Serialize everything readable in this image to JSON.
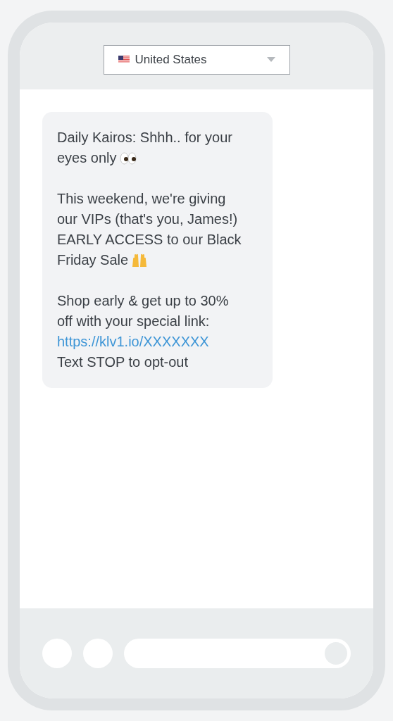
{
  "country_select": {
    "value": "United States"
  },
  "message": {
    "paragraphs": [
      {
        "lines": [
          {
            "kind": "text",
            "text": "Daily Kairos: Shhh.. for your"
          },
          {
            "kind": "eyes",
            "text": "eyes only"
          }
        ]
      },
      {
        "lines": [
          {
            "kind": "text",
            "text": "This weekend, we're giving"
          },
          {
            "kind": "text",
            "text": "our VIPs (that's you, James!)"
          },
          {
            "kind": "text",
            "text": "EARLY ACCESS to our Black"
          },
          {
            "kind": "hands",
            "text": "Friday Sale"
          }
        ]
      },
      {
        "lines": [
          {
            "kind": "text",
            "text": "Shop early & get up to 30%"
          },
          {
            "kind": "text",
            "text": "off with your special link:"
          },
          {
            "kind": "link",
            "text": "https://klv1.io/XXXXXXX"
          },
          {
            "kind": "text",
            "text": "Text STOP to opt-out"
          }
        ]
      }
    ]
  }
}
